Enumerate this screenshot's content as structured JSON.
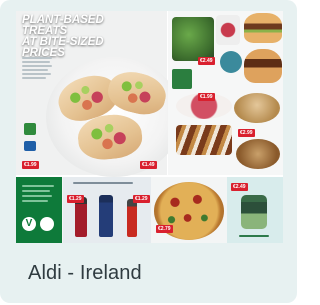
{
  "card": {
    "caption": "Aldi - Ireland",
    "background": "#e7f1f1",
    "caption_color": "#2f3b40"
  },
  "flyer": {
    "headline": "PLANT-BASED TREATS\nAT BITE-SIZED\nPRICES",
    "veg_badge": "V",
    "price_red": "#d9202e",
    "aldi_blue": "#1f5fa8"
  }
}
